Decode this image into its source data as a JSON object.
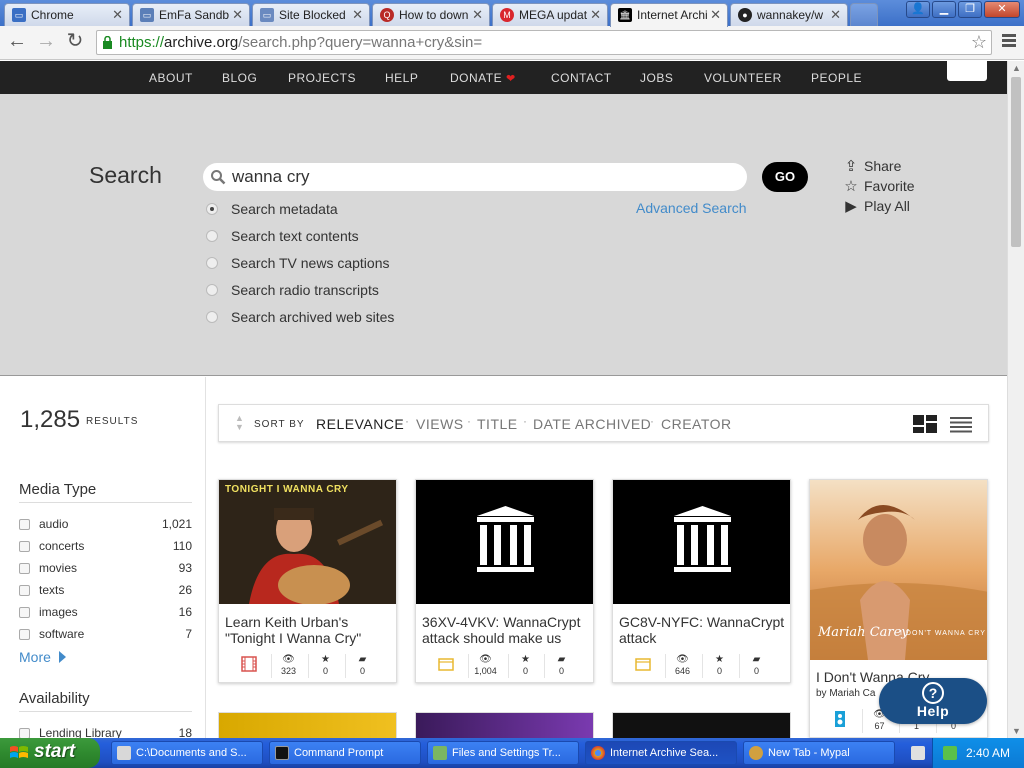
{
  "browser": {
    "tabs": [
      {
        "label": "Chrome",
        "icon_color": "#3a6fc4"
      },
      {
        "label": "EmFa Sandb",
        "icon_color": "#5b7fb8"
      },
      {
        "label": "Site Blocked",
        "icon_color": "#6a8ac0"
      },
      {
        "label": "How to down",
        "icon_color": "#b92b27"
      },
      {
        "label": "MEGA updat",
        "icon_color": "#d9272e"
      },
      {
        "label": "Internet Archi",
        "icon_color": "#000000"
      },
      {
        "label": "wannakey/w",
        "icon_color": "#222222"
      }
    ],
    "url_scheme": "https://",
    "url_host": "archive.org",
    "url_path": "/search.php?query=wanna+cry&sin="
  },
  "topnav": {
    "items": [
      "ABOUT",
      "BLOG",
      "PROJECTS",
      "HELP",
      "DONATE",
      "CONTACT",
      "JOBS",
      "VOLUNTEER",
      "PEOPLE"
    ],
    "donate_heart": "❤"
  },
  "search": {
    "title": "Search",
    "query": "wanna cry",
    "go_label": "GO",
    "advanced_label": "Advanced Search",
    "options": [
      {
        "label": "Search metadata",
        "selected": true
      },
      {
        "label": "Search text contents",
        "selected": false
      },
      {
        "label": "Search TV news captions",
        "selected": false
      },
      {
        "label": "Search radio transcripts",
        "selected": false
      },
      {
        "label": "Search archived web sites",
        "selected": false
      }
    ],
    "side_links": [
      {
        "label": "Share",
        "icon": "share-icon"
      },
      {
        "label": "Favorite",
        "icon": "star-icon"
      },
      {
        "label": "Play All",
        "icon": "play-icon"
      }
    ]
  },
  "results": {
    "count": "1,285",
    "label": "RESULTS"
  },
  "facets": {
    "media_title": "Media Type",
    "media": [
      {
        "label": "audio",
        "count": "1,021"
      },
      {
        "label": "concerts",
        "count": "110"
      },
      {
        "label": "movies",
        "count": "93"
      },
      {
        "label": "texts",
        "count": "26"
      },
      {
        "label": "images",
        "count": "16"
      },
      {
        "label": "software",
        "count": "7"
      }
    ],
    "more_label": "More",
    "availability_title": "Availability",
    "availability": [
      {
        "label": "Lending Library",
        "count": "18"
      }
    ]
  },
  "sort": {
    "label": "SORT BY",
    "options": [
      "RELEVANCE",
      "VIEWS",
      "TITLE",
      "DATE ARCHIVED",
      "CREATOR"
    ],
    "active": "RELEVANCE"
  },
  "cards": [
    {
      "title": "Learn Keith Urban's \"Tonight I Wanna Cry\"",
      "thumb_text": "TONIGHT I WANNA CRY",
      "type": "movies",
      "type_icon": "film-icon",
      "views": "323",
      "favorites": "0",
      "reviews": "0"
    },
    {
      "title": "36XV-4VKV: WannaCrypt attack should make us",
      "type": "texts",
      "type_icon": "folder-icon",
      "views": "1,004",
      "favorites": "0",
      "reviews": "0"
    },
    {
      "title": "GC8V-NYFC: WannaCrypt attack",
      "type": "texts",
      "type_icon": "folder-icon",
      "views": "646",
      "favorites": "0",
      "reviews": "0"
    },
    {
      "title": "I Don't Wanna Cry",
      "byline": "by Mariah Ca",
      "thumb_text": "Mariah Carey",
      "thumb_subtext": "I DON'T WANNA CRY",
      "type": "audio",
      "type_icon": "audio-icon",
      "views": "67",
      "favorites": "1",
      "reviews": "0"
    }
  ],
  "help": {
    "label": "Help"
  },
  "taskbar": {
    "start_label": "start",
    "tasks": [
      {
        "label": "C:\\Documents and S...",
        "color": "#d8d8d8"
      },
      {
        "label": "Command Prompt",
        "color": "#111111"
      },
      {
        "label": "Files and Settings Tr...",
        "color": "#7bb661"
      },
      {
        "label": "Internet Archive Sea...",
        "color": "#e0a020"
      },
      {
        "label": "New Tab - Mypal",
        "color": "#d0a040"
      }
    ],
    "clock": "2:40 AM"
  }
}
